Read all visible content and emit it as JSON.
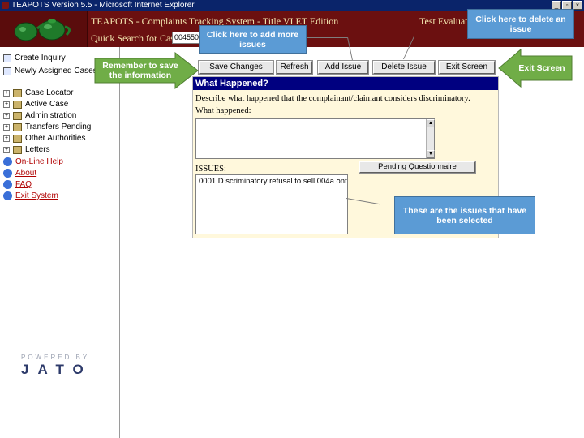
{
  "window": {
    "title": "TEAPOTS Version 5.5 - Microsoft Internet Explorer",
    "min_label": "_",
    "max_label": "▫",
    "close_label": "×"
  },
  "header": {
    "app_name": "TEAPOTS - Complaints Tracking System - Title VI ET Edition",
    "quick_search_label": "Quick Search for Case",
    "quick_search_value": "004550",
    "right_label": "Test Evaluator"
  },
  "nav": {
    "items": [
      {
        "label": "Create Inquiry"
      },
      {
        "label": "Newly Assigned Cases"
      },
      {
        "label": "Case Locator"
      },
      {
        "label": "Active Case"
      },
      {
        "label": "Administration"
      },
      {
        "label": "Transfers Pending"
      },
      {
        "label": "Other Authorities"
      },
      {
        "label": "Letters"
      }
    ],
    "links": [
      {
        "label": "On-Line Help"
      },
      {
        "label": "About"
      },
      {
        "label": "FAQ"
      },
      {
        "label": "Exit System"
      }
    ],
    "powered_by": "POWERED BY",
    "brand": "JATO"
  },
  "toolbar": {
    "save": "Save Changes",
    "refresh": "Refresh",
    "add_issue": "Add Issue",
    "delete_issue": "Delete Issue",
    "exit_screen": "Exit Screen"
  },
  "form": {
    "header": "What Happened?",
    "describe": "Describe what happened that the complainant/claimant considers discriminatory.",
    "what_label": "What happened:",
    "what_value": "",
    "issues_label": "ISSUES:",
    "pending_button": "Pending Questionnaire",
    "issues": [
      "0001 D scriminatory refusal to sell 004a.ont"
    ]
  },
  "callouts": {
    "delete": "Click here to delete an issue",
    "add": "Click here to add more issues",
    "save": "Remember to save the information",
    "exit": "Exit Screen",
    "issues": "These are the issues that have been selected"
  },
  "colors": {
    "title_bar": "#0a246a",
    "banner": "#6b1010",
    "panel_header": "#000080",
    "panel_bg": "#fff8dc",
    "callout_blue": "#5b9bd5",
    "arrow_green": "#70ad47",
    "link_red": "#b00000"
  }
}
